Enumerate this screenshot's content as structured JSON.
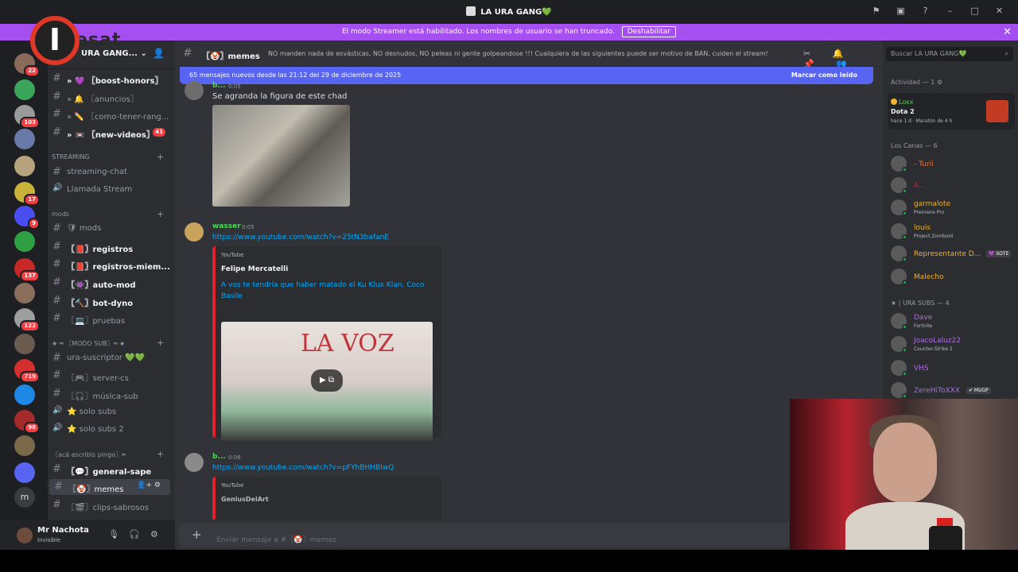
{
  "window": {
    "title": "LA URA GANG💚",
    "controls": [
      "⚑",
      "▣",
      "?",
      "–",
      "□",
      "✕"
    ]
  },
  "streamer": {
    "text": "El modo Streamer está habilitado. Los nombres de usuario se han truncado.",
    "button": "Deshabilitar",
    "close": "✕"
  },
  "overlay_logo": {
    "letter": "I",
    "text": "esat"
  },
  "server": {
    "name": "URA GANG..."
  },
  "guilds": [
    {
      "badge": "22",
      "color": "#8a6a5a"
    },
    {
      "badge": "",
      "color": "#3ba55c"
    },
    {
      "badge": "103",
      "color": "#9a9a9a"
    },
    {
      "badge": "",
      "color": "#6a7aa8"
    },
    {
      "badge": "",
      "color": "#b7a27e"
    },
    {
      "badge": "17",
      "color": "#c8b23a"
    },
    {
      "badge": "9",
      "color": "#4a4ef0"
    },
    {
      "badge": "",
      "color": "#2ea043"
    },
    {
      "badge": "137",
      "color": "#c62828"
    },
    {
      "badge": "",
      "color": "#8a6d5a"
    },
    {
      "badge": "122",
      "color": "#9e9e9e"
    },
    {
      "badge": "",
      "color": "#6b5a4e"
    },
    {
      "badge": "719",
      "color": "#d32f2f"
    },
    {
      "badge": "",
      "color": "#1e88e5"
    },
    {
      "badge": "98",
      "color": "#a52a2a"
    },
    {
      "badge": "",
      "color": "#7a6a4a"
    },
    {
      "badge": "",
      "color": "#5865f2"
    },
    {
      "badge": "m",
      "color": "#3a3c41"
    }
  ],
  "channels": {
    "items": [
      {
        "label": "» 💜 〖boost-honors〗",
        "unread": true,
        "count": ""
      },
      {
        "label": "» 🔔 〖anuncios〗",
        "unread": false,
        "count": ""
      },
      {
        "label": "» ✏️ 〖como-tener-rang...",
        "unread": false,
        "count": ""
      },
      {
        "label": "» 📼 〖new-videos〗",
        "unread": true,
        "count": "41"
      }
    ],
    "cat_streaming": "STREAMING",
    "streaming": [
      {
        "label": "streaming-chat",
        "icon": "#"
      },
      {
        "label": "Llamada Stream",
        "icon": "🔊"
      }
    ],
    "cat_mods": "mods",
    "mods": [
      {
        "label": "🛡 mods",
        "unread": false
      },
      {
        "label": "〖📕〗registros",
        "unread": true
      },
      {
        "label": "〖📕〗registros-miem...",
        "unread": true
      },
      {
        "label": "〖👾〗auto-mod",
        "unread": true
      },
      {
        "label": "〖🔨〗bot-dyno",
        "unread": true
      },
      {
        "label": "〖💻〗pruebas",
        "unread": false
      }
    ],
    "cat_subs": "★ ═ 〖MODO SUB〗═ ★",
    "subs": [
      {
        "label": "ura-suscriptor 💚💚",
        "icon": "#"
      },
      {
        "label": "〖🎮〗server-cs",
        "icon": "#"
      },
      {
        "label": "〖🎧〗música-sub",
        "icon": "#"
      },
      {
        "label": "⭐ solo subs",
        "icon": "🔊"
      },
      {
        "label": "⭐ solo subs 2",
        "icon": "🔊"
      }
    ],
    "cat_write": "〖acá escribis pingo〗═",
    "write": [
      {
        "label": "〖💬〗general-sape",
        "unread": true
      },
      {
        "label": "〖🤡〗memes",
        "unread": false,
        "active": true
      },
      {
        "label": "〖🎬〗clips-sabrosos",
        "unread": false
      }
    ]
  },
  "user": {
    "name": "Mr Nachota",
    "status": "Invisible",
    "controls": [
      "🎙",
      "🎧",
      "⚙"
    ]
  },
  "header": {
    "channel": "〖🤡〗memes",
    "topic": "NO manden nada de esvásticas, NO desnudos, NO peleas ni gente golpeandose !!! Cualquiera de las siguientes puede ser motivo de BAN, cuiden el stream!",
    "icons": "✂ 🔔 📌 👥",
    "search_placeholder": "Buscar LA URA GANG💚"
  },
  "newbar": {
    "text": "65 mensajes nuevos desde las 21:12 del 29 de diciembre de 2025",
    "mark": "Marcar como leído"
  },
  "messages": [
    {
      "author": "b...",
      "time": "0:05",
      "text": "Se agranda la figura de este chad"
    },
    {
      "author": "wasser",
      "time": "0:05",
      "link": "https://www.youtube.com/watch?v=25tN3bafanE",
      "embed": {
        "provider": "YouTube",
        "author": "Felipe Mercatelli",
        "title": "A vos te tendría que haber matado el Ku Klux Klan. Coco Basile",
        "video_brand": "LA VOZ"
      }
    },
    {
      "author": "b...",
      "time": "0:06",
      "link": "https://www.youtube.com/watch?v=pFYhBHHBIwQ",
      "embed": {
        "provider": "YouTube",
        "author": "GeniusDelArt"
      }
    }
  ],
  "composer": {
    "placeholder": "Enviar mensaje a #〖🤡〗memes",
    "plus": "+"
  },
  "members": {
    "activity_header": "Actividad — 1 ⚙",
    "activity": {
      "who": "Loxx",
      "game": "Dota 2",
      "detail": "hace 1 d · Maratón de 4 h"
    },
    "group1": "Los Canas — 6",
    "group1_members": [
      {
        "name": "- Turii",
        "sub": "",
        "color": "#f0733a"
      },
      {
        "name": "A...",
        "sub": "",
        "color": "#e0202a"
      },
      {
        "name": "garmalote",
        "sub": "Premiere Pro",
        "color": "#f0b232"
      },
      {
        "name": "louis",
        "sub": "Project Zomboid",
        "color": "#f0b232"
      },
      {
        "name": "Representante D...",
        "sub": "",
        "color": "#f0b232",
        "tag": "💜 SOTE"
      },
      {
        "name": "Malecho",
        "sub": "",
        "color": "#f0b232"
      }
    ],
    "group2": "★ | URA SUBS — 4",
    "group2_members": [
      {
        "name": "Dave",
        "sub": "Fortnite",
        "color": "#a86ee0"
      },
      {
        "name": "JoacoLaluz22",
        "sub": "Counter-Strike 2",
        "color": "#a86ee0"
      },
      {
        "name": "VHS",
        "sub": "",
        "color": "#a86ee0"
      },
      {
        "name": "ZereHiToXXX",
        "sub": "",
        "color": "#a86ee0",
        "tag": "✔ MUGP"
      }
    ]
  }
}
